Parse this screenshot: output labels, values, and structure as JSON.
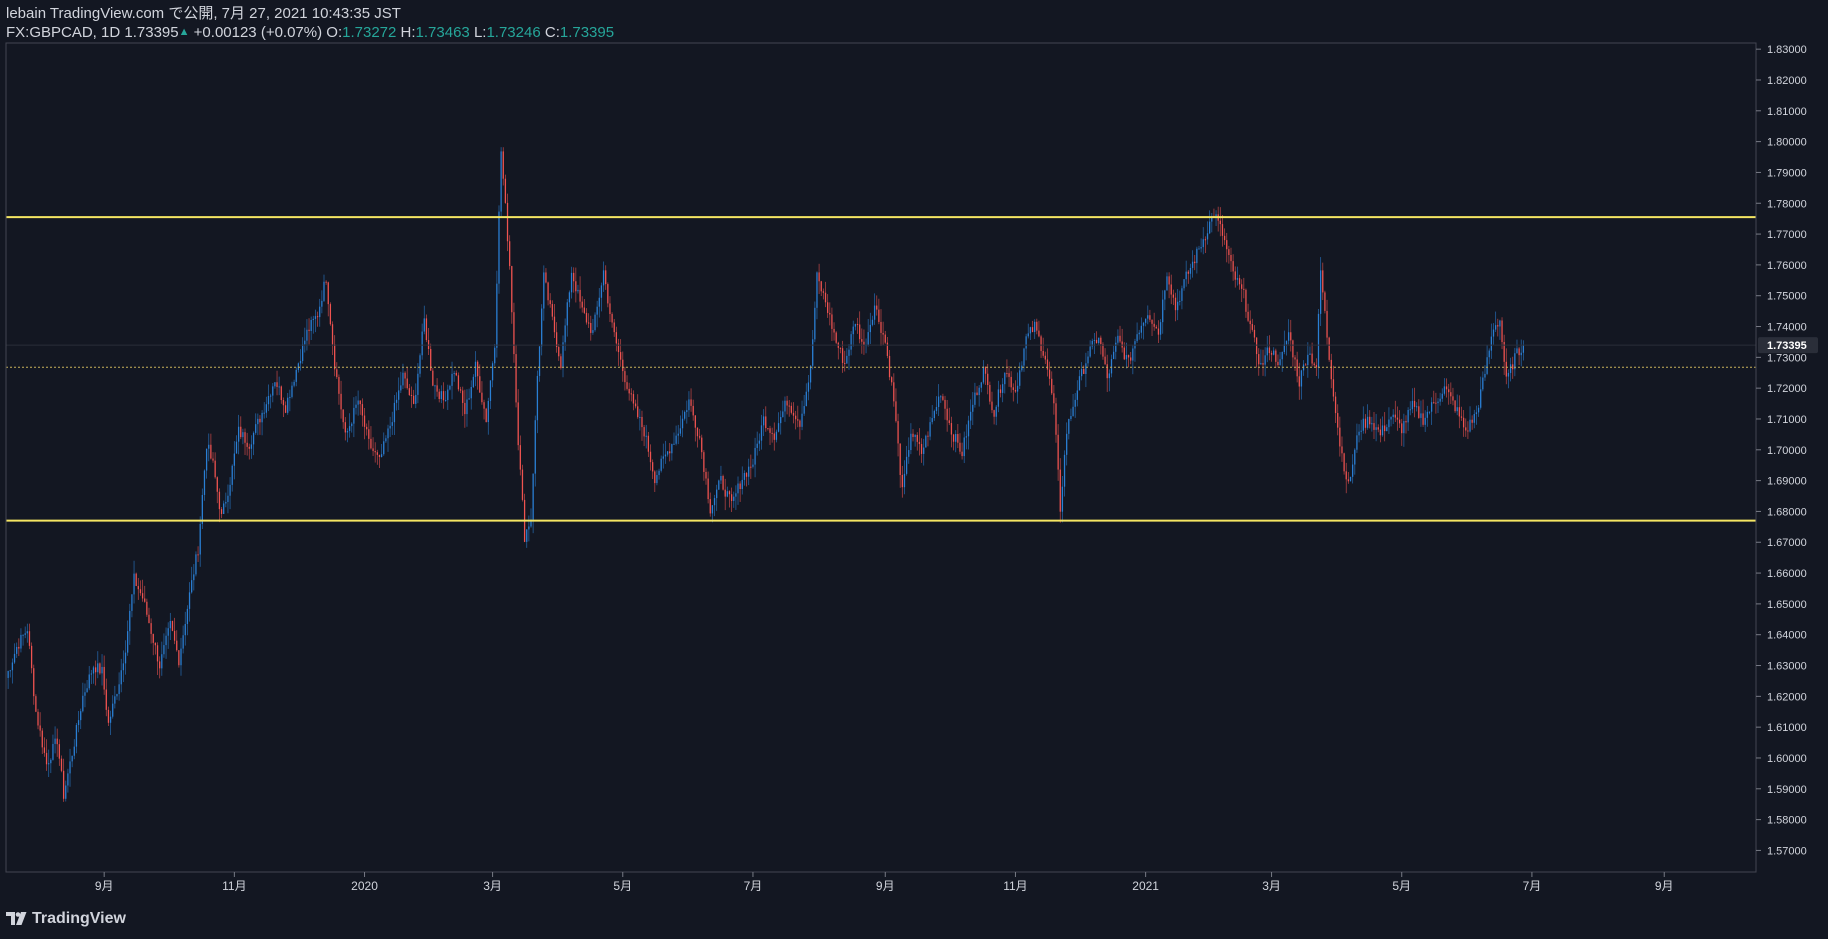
{
  "header": {
    "published": "lebain TradingView.com で公開, 7月 27, 2021 10:43:35 JST",
    "symbol": "FX:GBPCAD, 1D",
    "last": "1.73395",
    "change": "+0.00123 (+0.07%)",
    "o_label": "O:",
    "o_value": "1.73272",
    "h_label": "H:",
    "h_value": "1.73463",
    "l_label": "L:",
    "l_value": "1.73246",
    "c_label": "C:",
    "c_value": "1.73395"
  },
  "footer": {
    "brand": "TradingView"
  },
  "colors": {
    "background": "#131722",
    "up": "#2a7fd4",
    "down": "#ef5350",
    "level_line": "#f5e663",
    "price_line": "#c9b25a",
    "axis_text": "#d1d4dc"
  },
  "chart_data": {
    "type": "candlestick",
    "symbol": "FX:GBPCAD",
    "interval": "1D",
    "y_axis": {
      "ticks": [
        "1.83000",
        "1.82000",
        "1.81000",
        "1.80000",
        "1.79000",
        "1.78000",
        "1.77000",
        "1.76000",
        "1.75000",
        "1.74000",
        "1.73000",
        "1.72000",
        "1.71000",
        "1.70000",
        "1.69000",
        "1.68000",
        "1.67000",
        "1.66000",
        "1.65000",
        "1.64000",
        "1.63000",
        "1.62000",
        "1.61000",
        "1.60000",
        "1.59000",
        "1.58000",
        "1.57000"
      ],
      "range": [
        1.563,
        1.832
      ],
      "last_price_label": "1.73395"
    },
    "x_axis": {
      "ticks": [
        "9月",
        "11月",
        "2020",
        "3月",
        "5月",
        "7月",
        "9月",
        "11月",
        "2021",
        "3月",
        "5月",
        "7月",
        "9月"
      ],
      "tick_days": [
        46,
        107,
        168,
        228,
        289,
        350,
        412,
        473,
        534,
        593,
        654,
        715,
        777
      ],
      "range_days": [
        0,
        820
      ]
    },
    "horizontal_levels": [
      1.7755,
      1.677
    ],
    "reference_price": 1.7268,
    "anchors": [
      {
        "d": 0,
        "p": 1.626
      },
      {
        "d": 5,
        "p": 1.636
      },
      {
        "d": 10,
        "p": 1.642
      },
      {
        "d": 14,
        "p": 1.615
      },
      {
        "d": 19,
        "p": 1.598
      },
      {
        "d": 24,
        "p": 1.606
      },
      {
        "d": 27,
        "p": 1.588
      },
      {
        "d": 32,
        "p": 1.605
      },
      {
        "d": 36,
        "p": 1.62
      },
      {
        "d": 41,
        "p": 1.63
      },
      {
        "d": 45,
        "p": 1.628
      },
      {
        "d": 48,
        "p": 1.611
      },
      {
        "d": 53,
        "p": 1.625
      },
      {
        "d": 56,
        "p": 1.636
      },
      {
        "d": 60,
        "p": 1.658
      },
      {
        "d": 64,
        "p": 1.652
      },
      {
        "d": 67,
        "p": 1.644
      },
      {
        "d": 72,
        "p": 1.63
      },
      {
        "d": 77,
        "p": 1.643
      },
      {
        "d": 81,
        "p": 1.632
      },
      {
        "d": 86,
        "p": 1.653
      },
      {
        "d": 90,
        "p": 1.668
      },
      {
        "d": 94,
        "p": 1.702
      },
      {
        "d": 97,
        "p": 1.695
      },
      {
        "d": 101,
        "p": 1.678
      },
      {
        "d": 105,
        "p": 1.69
      },
      {
        "d": 109,
        "p": 1.706
      },
      {
        "d": 114,
        "p": 1.702
      },
      {
        "d": 120,
        "p": 1.712
      },
      {
        "d": 126,
        "p": 1.723
      },
      {
        "d": 131,
        "p": 1.714
      },
      {
        "d": 136,
        "p": 1.726
      },
      {
        "d": 141,
        "p": 1.738
      },
      {
        "d": 146,
        "p": 1.744
      },
      {
        "d": 150,
        "p": 1.756
      },
      {
        "d": 154,
        "p": 1.728
      },
      {
        "d": 159,
        "p": 1.704
      },
      {
        "d": 165,
        "p": 1.716
      },
      {
        "d": 170,
        "p": 1.702
      },
      {
        "d": 175,
        "p": 1.696
      },
      {
        "d": 180,
        "p": 1.708
      },
      {
        "d": 186,
        "p": 1.724
      },
      {
        "d": 191,
        "p": 1.714
      },
      {
        "d": 196,
        "p": 1.742
      },
      {
        "d": 200,
        "p": 1.722
      },
      {
        "d": 205,
        "p": 1.716
      },
      {
        "d": 210,
        "p": 1.726
      },
      {
        "d": 215,
        "p": 1.712
      },
      {
        "d": 220,
        "p": 1.727
      },
      {
        "d": 225,
        "p": 1.71
      },
      {
        "d": 229,
        "p": 1.735
      },
      {
        "d": 232,
        "p": 1.797
      },
      {
        "d": 236,
        "p": 1.76
      },
      {
        "d": 240,
        "p": 1.703
      },
      {
        "d": 243,
        "p": 1.672
      },
      {
        "d": 246,
        "p": 1.678
      },
      {
        "d": 249,
        "p": 1.724
      },
      {
        "d": 252,
        "p": 1.756
      },
      {
        "d": 256,
        "p": 1.742
      },
      {
        "d": 260,
        "p": 1.728
      },
      {
        "d": 265,
        "p": 1.758
      },
      {
        "d": 270,
        "p": 1.745
      },
      {
        "d": 275,
        "p": 1.738
      },
      {
        "d": 280,
        "p": 1.758
      },
      {
        "d": 284,
        "p": 1.74
      },
      {
        "d": 289,
        "p": 1.726
      },
      {
        "d": 294,
        "p": 1.714
      },
      {
        "d": 299,
        "p": 1.706
      },
      {
        "d": 304,
        "p": 1.691
      },
      {
        "d": 309,
        "p": 1.698
      },
      {
        "d": 315,
        "p": 1.706
      },
      {
        "d": 320,
        "p": 1.716
      },
      {
        "d": 325,
        "p": 1.704
      },
      {
        "d": 330,
        "p": 1.681
      },
      {
        "d": 335,
        "p": 1.69
      },
      {
        "d": 340,
        "p": 1.682
      },
      {
        "d": 345,
        "p": 1.691
      },
      {
        "d": 350,
        "p": 1.696
      },
      {
        "d": 355,
        "p": 1.71
      },
      {
        "d": 360,
        "p": 1.705
      },
      {
        "d": 366,
        "p": 1.716
      },
      {
        "d": 372,
        "p": 1.709
      },
      {
        "d": 377,
        "p": 1.726
      },
      {
        "d": 380,
        "p": 1.756
      },
      {
        "d": 384,
        "p": 1.748
      },
      {
        "d": 389,
        "p": 1.735
      },
      {
        "d": 393,
        "p": 1.728
      },
      {
        "d": 398,
        "p": 1.742
      },
      {
        "d": 402,
        "p": 1.733
      },
      {
        "d": 407,
        "p": 1.747
      },
      {
        "d": 412,
        "p": 1.735
      },
      {
        "d": 416,
        "p": 1.716
      },
      {
        "d": 420,
        "p": 1.686
      },
      {
        "d": 424,
        "p": 1.706
      },
      {
        "d": 429,
        "p": 1.699
      },
      {
        "d": 434,
        "p": 1.71
      },
      {
        "d": 438,
        "p": 1.719
      },
      {
        "d": 443,
        "p": 1.706
      },
      {
        "d": 448,
        "p": 1.699
      },
      {
        "d": 453,
        "p": 1.715
      },
      {
        "d": 458,
        "p": 1.726
      },
      {
        "d": 463,
        "p": 1.712
      },
      {
        "d": 468,
        "p": 1.726
      },
      {
        "d": 473,
        "p": 1.719
      },
      {
        "d": 478,
        "p": 1.736
      },
      {
        "d": 482,
        "p": 1.74
      },
      {
        "d": 487,
        "p": 1.73
      },
      {
        "d": 491,
        "p": 1.714
      },
      {
        "d": 494,
        "p": 1.681
      },
      {
        "d": 497,
        "p": 1.706
      },
      {
        "d": 502,
        "p": 1.72
      },
      {
        "d": 507,
        "p": 1.731
      },
      {
        "d": 512,
        "p": 1.737
      },
      {
        "d": 516,
        "p": 1.723
      },
      {
        "d": 521,
        "p": 1.736
      },
      {
        "d": 526,
        "p": 1.728
      },
      {
        "d": 530,
        "p": 1.738
      },
      {
        "d": 535,
        "p": 1.745
      },
      {
        "d": 540,
        "p": 1.738
      },
      {
        "d": 544,
        "p": 1.758
      },
      {
        "d": 548,
        "p": 1.746
      },
      {
        "d": 553,
        "p": 1.756
      },
      {
        "d": 557,
        "p": 1.762
      },
      {
        "d": 562,
        "p": 1.77
      },
      {
        "d": 566,
        "p": 1.777
      },
      {
        "d": 570,
        "p": 1.77
      },
      {
        "d": 575,
        "p": 1.757
      },
      {
        "d": 580,
        "p": 1.75
      },
      {
        "d": 584,
        "p": 1.737
      },
      {
        "d": 588,
        "p": 1.727
      },
      {
        "d": 592,
        "p": 1.733
      },
      {
        "d": 597,
        "p": 1.728
      },
      {
        "d": 601,
        "p": 1.738
      },
      {
        "d": 606,
        "p": 1.722
      },
      {
        "d": 610,
        "p": 1.732
      },
      {
        "d": 614,
        "p": 1.727
      },
      {
        "d": 616,
        "p": 1.758
      },
      {
        "d": 620,
        "p": 1.73
      },
      {
        "d": 625,
        "p": 1.702
      },
      {
        "d": 629,
        "p": 1.688
      },
      {
        "d": 634,
        "p": 1.707
      },
      {
        "d": 639,
        "p": 1.71
      },
      {
        "d": 644,
        "p": 1.705
      },
      {
        "d": 649,
        "p": 1.711
      },
      {
        "d": 654,
        "p": 1.707
      },
      {
        "d": 659,
        "p": 1.714
      },
      {
        "d": 664,
        "p": 1.71
      },
      {
        "d": 669,
        "p": 1.715
      },
      {
        "d": 674,
        "p": 1.72
      },
      {
        "d": 679,
        "p": 1.714
      },
      {
        "d": 684,
        "p": 1.706
      },
      {
        "d": 689,
        "p": 1.712
      },
      {
        "d": 693,
        "p": 1.725
      },
      {
        "d": 697,
        "p": 1.74
      },
      {
        "d": 700,
        "p": 1.742
      },
      {
        "d": 703,
        "p": 1.722
      },
      {
        "d": 707,
        "p": 1.73
      },
      {
        "d": 711,
        "p": 1.734
      }
    ]
  }
}
